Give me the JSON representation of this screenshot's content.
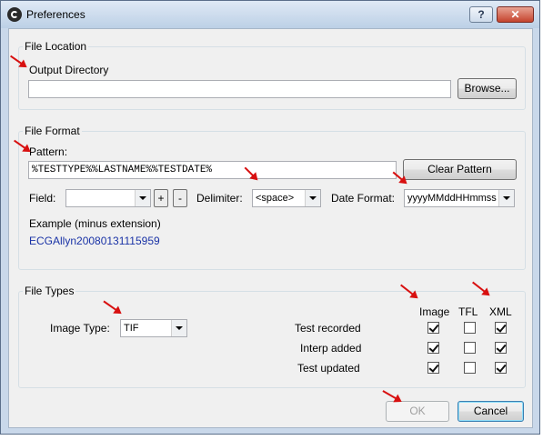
{
  "window": {
    "title": "Preferences",
    "help_label": "?",
    "close_label": "✕"
  },
  "file_location": {
    "legend": "File Location",
    "output_dir_label": "Output Directory",
    "output_dir_value": "",
    "browse_label": "Browse..."
  },
  "file_format": {
    "legend": "File Format",
    "pattern_label": "Pattern:",
    "pattern_value": "%TESTTYPE%%LASTNAME%%TESTDATE%",
    "clear_label": "Clear Pattern",
    "field_label": "Field:",
    "field_value": "",
    "plus_label": "+",
    "minus_label": "-",
    "delimiter_label": "Delimiter:",
    "delimiter_value": "<space>",
    "date_format_label": "Date Format:",
    "date_format_value": "yyyyMMddHHmmss",
    "example_label": "Example (minus extension)",
    "example_value": "ECGAllyn20080131115959"
  },
  "file_types": {
    "legend": "File Types",
    "image_type_label": "Image Type:",
    "image_type_value": "TIF",
    "columns": [
      "Image",
      "TFL",
      "XML"
    ],
    "rows": [
      {
        "label": "Test recorded",
        "checks": [
          true,
          false,
          true
        ]
      },
      {
        "label": "Interp added",
        "checks": [
          true,
          false,
          true
        ]
      },
      {
        "label": "Test updated",
        "checks": [
          true,
          false,
          true
        ]
      }
    ]
  },
  "footer": {
    "ok_label": "OK",
    "cancel_label": "Cancel"
  },
  "colors": {
    "annotation_arrow": "#d81010",
    "link": "#1a33a6"
  }
}
